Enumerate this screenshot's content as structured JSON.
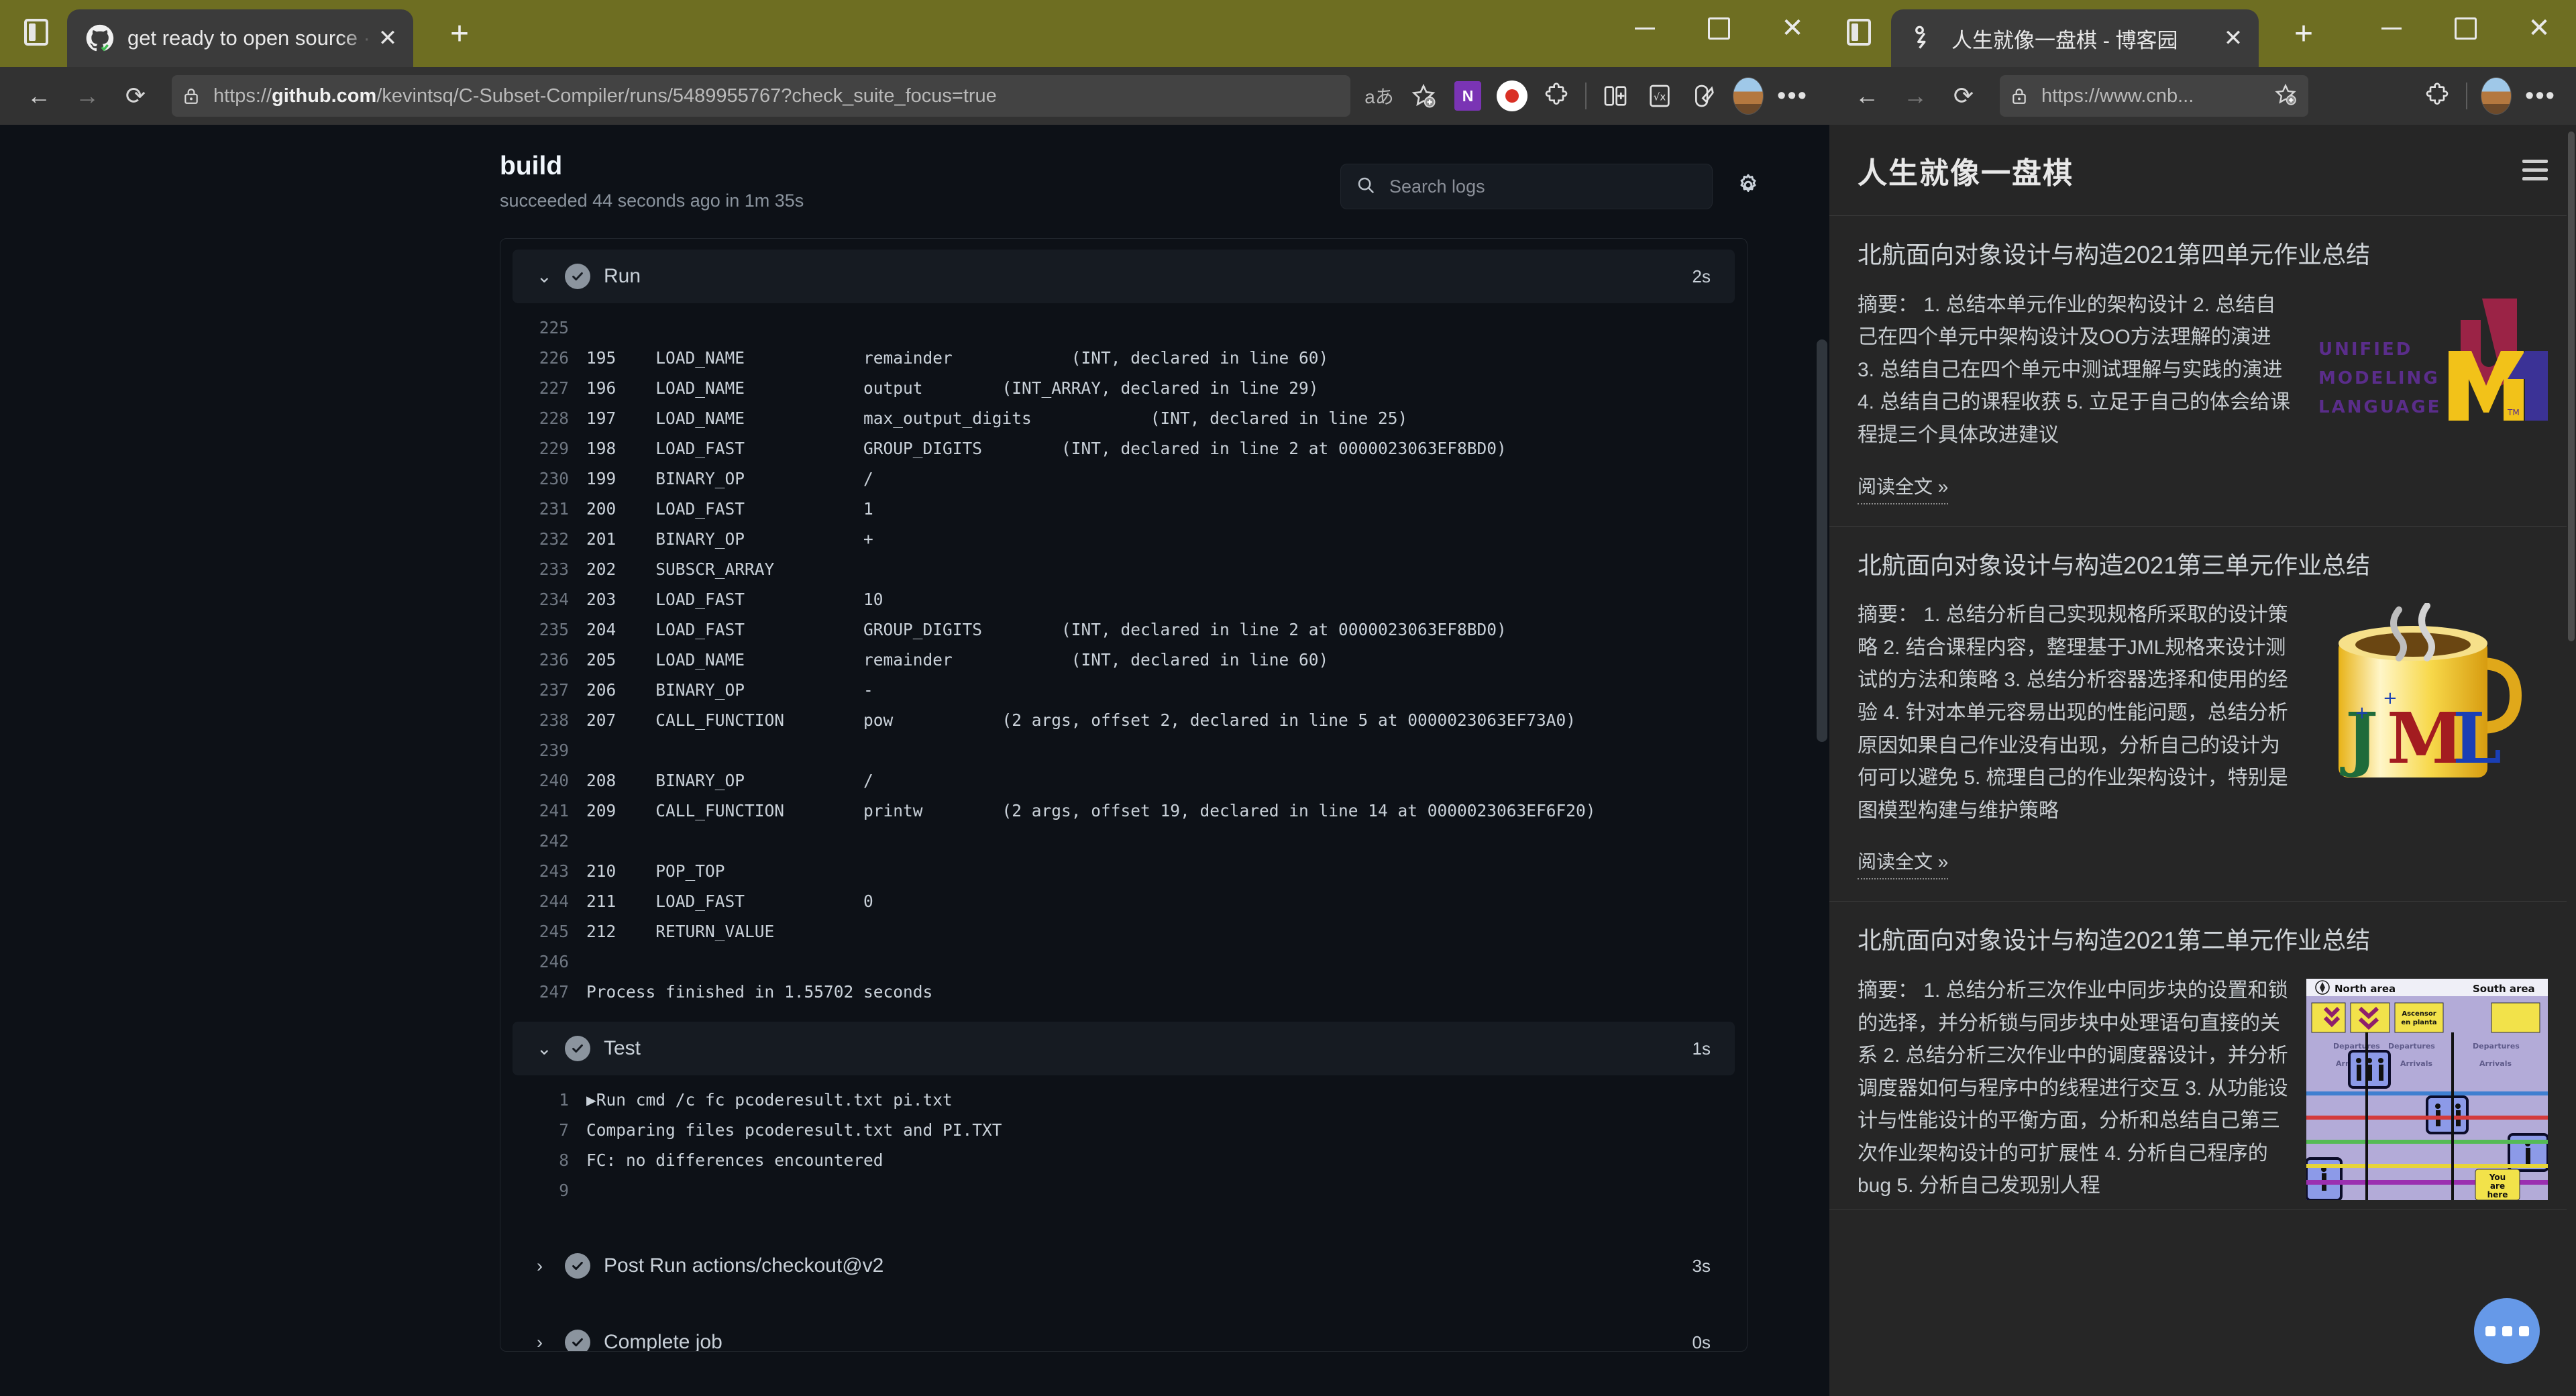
{
  "left_window": {
    "tab": {
      "title": "get ready to open source · kevintsq/C-Subset-Compiler",
      "favicon": "github-icon",
      "close_label": "✕",
      "new_tab_label": "+"
    },
    "window_controls": {
      "minimize": "–",
      "maximize": "▢",
      "close": "✕"
    },
    "toolbar": {
      "back": "←",
      "forward": "→",
      "refresh": "⟳",
      "url_prefix": "https://",
      "url_bold": "github.com",
      "url_rest": "/kevintsq/C-Subset-Compiler/runs/5489955767?check_suite_focus=true",
      "translate": "aあ",
      "favorite": "☆",
      "onenote": "N",
      "collections": "⬤",
      "extensions": "puzzle-icon",
      "split": "split-screen-icon",
      "math": "√x",
      "drop": "drop-icon",
      "profile": "avatar",
      "more": "•••"
    },
    "github": {
      "job_title": "build",
      "job_subtitle": "succeeded 44 seconds ago in 1m 35s",
      "search_placeholder": "Search logs",
      "settings_icon": "gear-icon",
      "steps": [
        {
          "name": "Run",
          "time": "2s",
          "expanded": true,
          "status": "success"
        },
        {
          "name": "Test",
          "time": "1s",
          "expanded": true,
          "status": "success"
        },
        {
          "name": "Post Run actions/checkout@v2",
          "time": "3s",
          "expanded": false,
          "status": "success"
        },
        {
          "name": "Complete job",
          "time": "0s",
          "expanded": false,
          "status": "success"
        }
      ],
      "run_log": [
        {
          "n": "225",
          "t": ""
        },
        {
          "n": "226",
          "t": "195    LOAD_NAME            remainder            (INT, declared in line 60)"
        },
        {
          "n": "227",
          "t": "196    LOAD_NAME            output        (INT_ARRAY, declared in line 29)"
        },
        {
          "n": "228",
          "t": "197    LOAD_NAME            max_output_digits            (INT, declared in line 25)"
        },
        {
          "n": "229",
          "t": "198    LOAD_FAST            GROUP_DIGITS        (INT, declared in line 2 at 0000023063EF8BD0)"
        },
        {
          "n": "230",
          "t": "199    BINARY_OP            /"
        },
        {
          "n": "231",
          "t": "200    LOAD_FAST            1"
        },
        {
          "n": "232",
          "t": "201    BINARY_OP            +"
        },
        {
          "n": "233",
          "t": "202    SUBSCR_ARRAY"
        },
        {
          "n": "234",
          "t": "203    LOAD_FAST            10"
        },
        {
          "n": "235",
          "t": "204    LOAD_FAST            GROUP_DIGITS        (INT, declared in line 2 at 0000023063EF8BD0)"
        },
        {
          "n": "236",
          "t": "205    LOAD_NAME            remainder            (INT, declared in line 60)"
        },
        {
          "n": "237",
          "t": "206    BINARY_OP            -"
        },
        {
          "n": "238",
          "t": "207    CALL_FUNCTION        pow           (2 args, offset 2, declared in line 5 at 0000023063EF73A0)"
        },
        {
          "n": "239",
          "t": ""
        },
        {
          "n": "240",
          "t": "208    BINARY_OP            /"
        },
        {
          "n": "241",
          "t": "209    CALL_FUNCTION        printw        (2 args, offset 19, declared in line 14 at 0000023063EF6F20)"
        },
        {
          "n": "242",
          "t": ""
        },
        {
          "n": "243",
          "t": "210    POP_TOP"
        },
        {
          "n": "244",
          "t": "211    LOAD_FAST            0"
        },
        {
          "n": "245",
          "t": "212    RETURN_VALUE"
        },
        {
          "n": "246",
          "t": ""
        },
        {
          "n": "247",
          "t": "Process finished in 1.55702 seconds"
        }
      ],
      "test_log": [
        {
          "n": "1",
          "t": "▶Run cmd /c fc pcoderesult.txt pi.txt"
        },
        {
          "n": "7",
          "t": "Comparing files pcoderesult.txt and PI.TXT"
        },
        {
          "n": "8",
          "t": "FC: no differences encountered"
        },
        {
          "n": "9",
          "t": ""
        }
      ]
    }
  },
  "right_window": {
    "tab": {
      "title": "人生就像一盘棋 - 博客园",
      "favicon": "cnblogs-icon",
      "close_label": "✕",
      "new_tab_label": "+"
    },
    "window_controls": {
      "minimize": "–",
      "maximize": "▢",
      "close": "✕"
    },
    "toolbar": {
      "back": "←",
      "forward": "→",
      "refresh": "⟳",
      "url": "https://www.cnb...",
      "favorite": "☆",
      "extensions": "puzzle-icon",
      "profile": "avatar",
      "more": "•••"
    },
    "blog": {
      "site_title": "人生就像一盘棋",
      "menu_icon": "hamburger-icon",
      "read_more_label": "阅读全文 »",
      "fab_label": "more-actions",
      "posts": [
        {
          "title": "北航面向对象设计与构造2021第四单元作业总结",
          "summary": "摘要：  1. 总结本单元作业的架构设计 2. 总结自己在四个单元中架构设计及OO方法理解的演进 3. 总结自己在四个单元中测试理解与实践的演进 4. 总结自己的课程收获 5. 立足于自己的体会给课程提三个具体改进建议",
          "thumb": "uml-logo"
        },
        {
          "title": "北航面向对象设计与构造2021第三单元作业总结",
          "summary": "摘要：  1. 总结分析自己实现规格所采取的设计策略 2. 结合课程内容，整理基于JML规格来设计测试的方法和策略 3. 总结分析容器选择和使用的经验 4. 针对本单元容易出现的性能问题，总结分析原因如果自己作业没有出现，分析自己的设计为何可以避免 5. 梳理自己的作业架构设计，特别是图模型构建与维护策略",
          "thumb": "jml-coffee-mug"
        },
        {
          "title": "北航面向对象设计与构造2021第二单元作业总结",
          "summary": "摘要：  1. 总结分析三次作业中同步块的设置和锁的选择，并分析锁与同步块中处理语句直接的关系 2. 总结分析三次作业中的调度器设计，并分析调度器如何与程序中的线程进行交互 3. 从功能设计与性能设计的平衡方面，分析和总结自己第三次作业架构设计的可扩展性 4. 分析自己程序的bug 5. 分析自己发现别人程",
          "thumb": "airport-map"
        }
      ]
    }
  },
  "colors": {
    "desktop": "#6e6e22",
    "chrome": "#323232",
    "github_bg": "#0d1117",
    "github_panel": "#161b22",
    "blog_bg": "#262626",
    "fab": "#6699e8"
  }
}
